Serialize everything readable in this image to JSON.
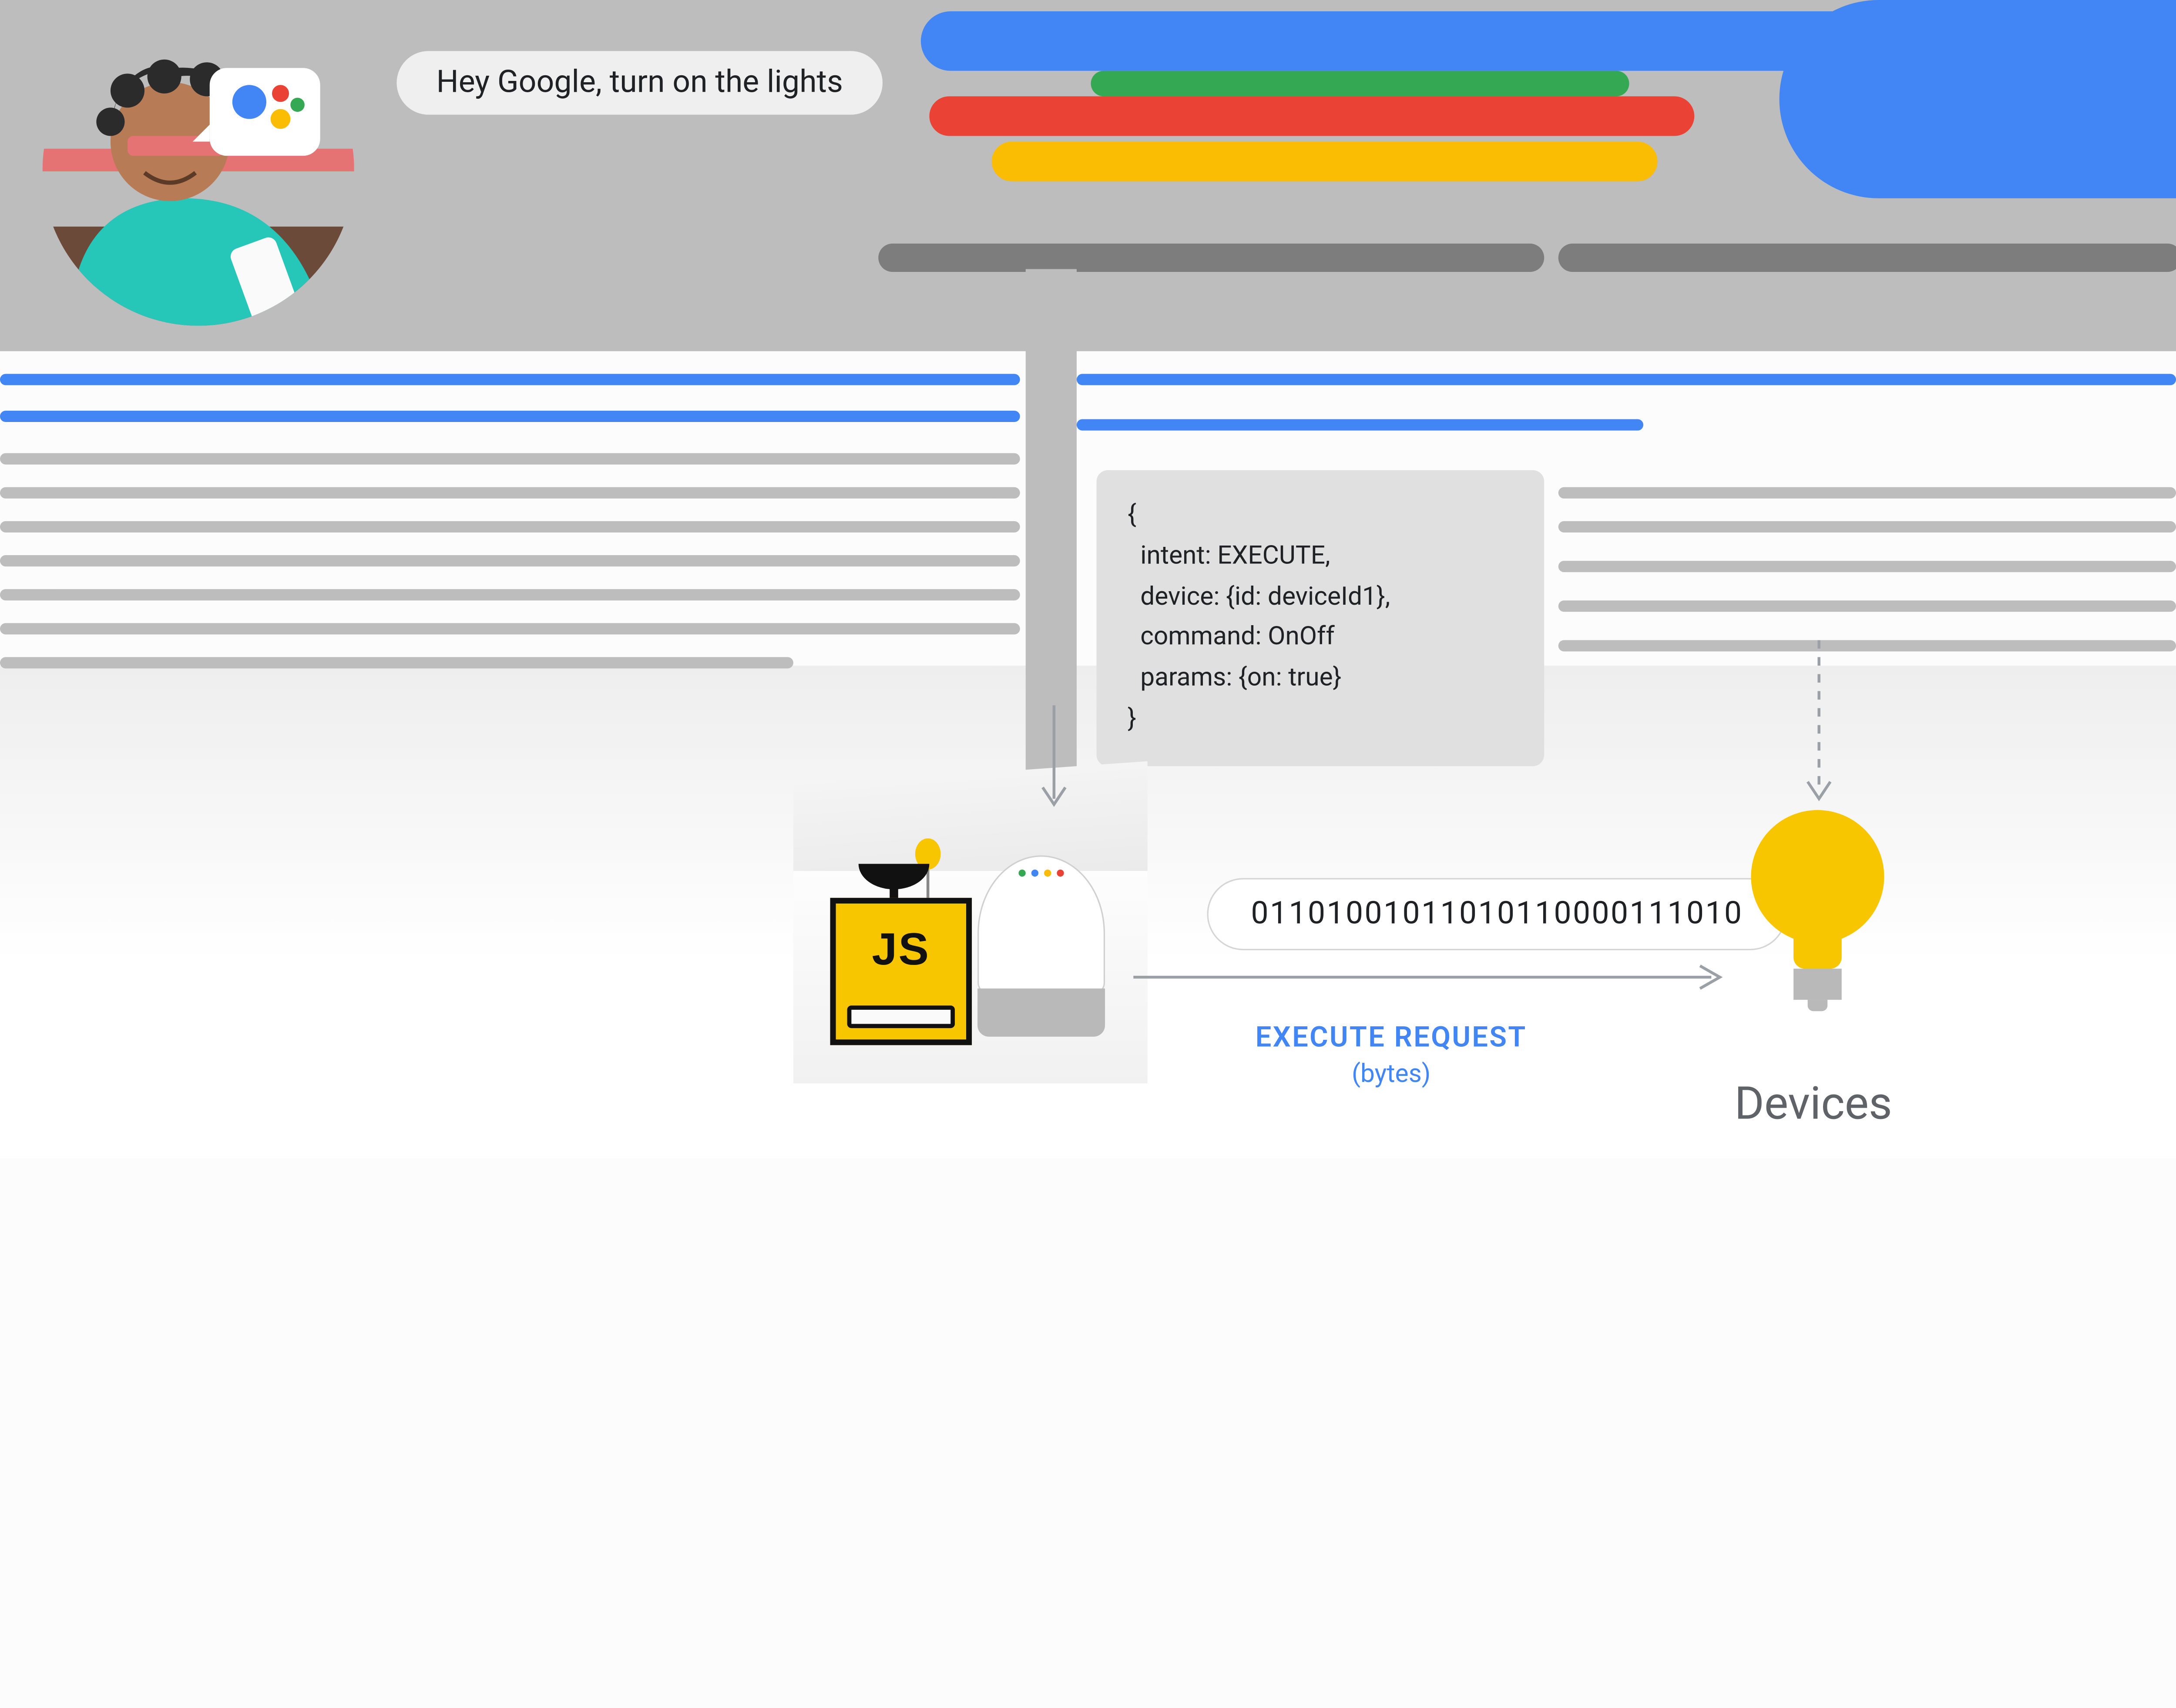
{
  "speech": {
    "text": "Hey Google, turn on the lights"
  },
  "code": {
    "l1": "{",
    "l2": "  intent: EXECUTE,",
    "l3": "  device: {id: deviceId1},",
    "l4": "  command: OnOff",
    "l5": "  params: {on: true}",
    "l6": "}"
  },
  "binary": {
    "value": "01101001011010110000111010"
  },
  "labels": {
    "execute": "EXECUTE REQUEST",
    "bytes": "(bytes)",
    "devices": "Devices"
  },
  "jschip": {
    "label": "JS"
  },
  "colors": {
    "blue": "#4285F4",
    "red": "#EA4335",
    "yellow": "#FBBC04",
    "green": "#34A853",
    "grey": "#9aa0a6",
    "darkgrey": "#5f6368"
  },
  "assistant_dots": [
    "#4285F4",
    "#EA4335",
    "#FBBC04",
    "#34A853"
  ]
}
